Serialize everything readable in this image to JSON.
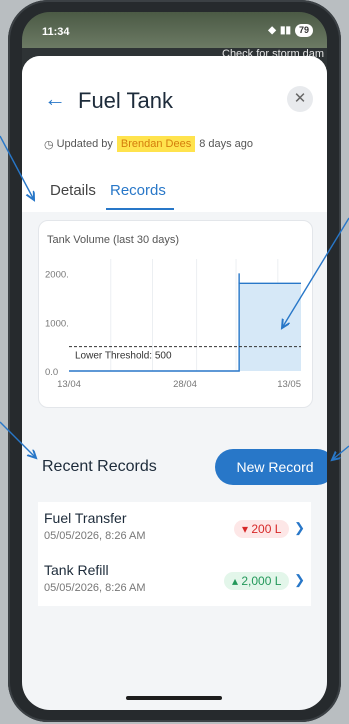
{
  "statusbar": {
    "time": "11:34",
    "battery": "79"
  },
  "background_banner": "Check for storm dam",
  "header": {
    "title": "Fuel Tank",
    "close_icon": "close-icon",
    "back_icon": "back-arrow-icon"
  },
  "updated": {
    "prefix": "Updated by",
    "user": "Brendan Dees",
    "when": "8 days ago"
  },
  "tabs": [
    {
      "label": "Details"
    },
    {
      "label": "Records"
    }
  ],
  "records_section": {
    "title": "Recent Records",
    "new_button": "New Record"
  },
  "records": [
    {
      "name": "Fuel Transfer",
      "date": "05/05/2026, 8:26 AM",
      "amount": "200 L",
      "direction": "down"
    },
    {
      "name": "Tank Refill",
      "date": "05/05/2026, 8:26 AM",
      "amount": "2,000 L",
      "direction": "up"
    }
  ],
  "colors": {
    "accent": "#2877c8",
    "threshold": "#333333",
    "area_fill": "#d6e8f7",
    "down": "#d62828",
    "up": "#23985a"
  },
  "chart_data": {
    "type": "area",
    "title": "Tank Volume (last 30 days)",
    "x_tick_labels": [
      "13/04",
      "28/04",
      "13/05"
    ],
    "y_tick_labels": [
      "2000.",
      "1000.",
      "0.0"
    ],
    "ylim": [
      0,
      2300
    ],
    "series": [
      {
        "values": [
          {
            "x": "13/04",
            "y": 0
          },
          {
            "x": "05/05",
            "y": 0
          },
          {
            "x": "05/05",
            "y": 1800
          },
          {
            "x": "13/05",
            "y": 1800
          }
        ]
      }
    ],
    "threshold": {
      "label": "Lower Threshold: 500",
      "value": 500
    },
    "grid": true
  }
}
